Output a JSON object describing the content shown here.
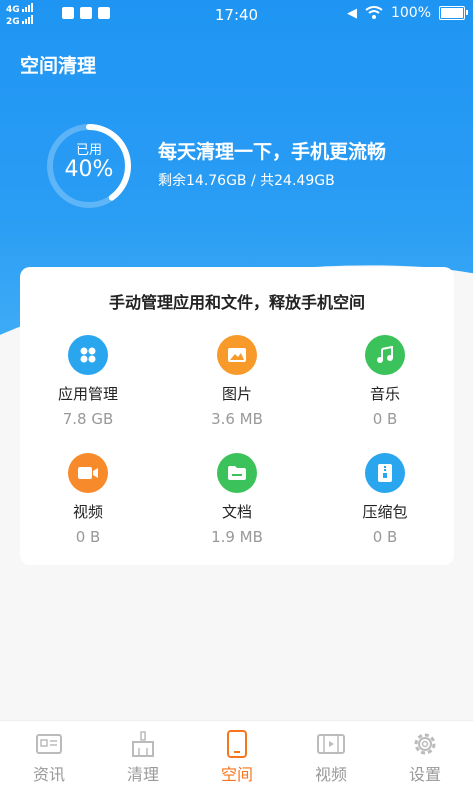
{
  "status_bar": {
    "network_1": "4G",
    "network_2": "2G",
    "time": "17:40",
    "battery": "100%"
  },
  "header": {
    "title": "空间清理"
  },
  "usage": {
    "used_label": "已用",
    "used_percent": "40%",
    "used_fraction": 0.4,
    "slogan": "每天清理一下，手机更流畅",
    "storage_info": "剩余14.76GB / 共24.49GB"
  },
  "card": {
    "title": "手动管理应用和文件，释放手机空间",
    "items": [
      {
        "name": "应用管理",
        "size": "7.8 GB",
        "icon": "apps-icon",
        "color": "#2aa6ee"
      },
      {
        "name": "图片",
        "size": "3.6 MB",
        "icon": "image-icon",
        "color": "#f79a2a"
      },
      {
        "name": "音乐",
        "size": "0 B",
        "icon": "music-icon",
        "color": "#3cc25a"
      },
      {
        "name": "视频",
        "size": "0 B",
        "icon": "video-icon",
        "color": "#f78a2a"
      },
      {
        "name": "文档",
        "size": "1.9 MB",
        "icon": "folder-icon",
        "color": "#3cc25a"
      },
      {
        "name": "压缩包",
        "size": "0 B",
        "icon": "zip-icon",
        "color": "#2aa6ee"
      }
    ]
  },
  "tabs": [
    {
      "label": "资讯",
      "icon": "news-icon"
    },
    {
      "label": "清理",
      "icon": "broom-icon"
    },
    {
      "label": "空间",
      "icon": "phone-icon",
      "active": true
    },
    {
      "label": "视频",
      "icon": "film-icon"
    },
    {
      "label": "设置",
      "icon": "gear-icon"
    }
  ],
  "colors": {
    "accent": "#f7751e",
    "hero": "#1f95f3"
  }
}
